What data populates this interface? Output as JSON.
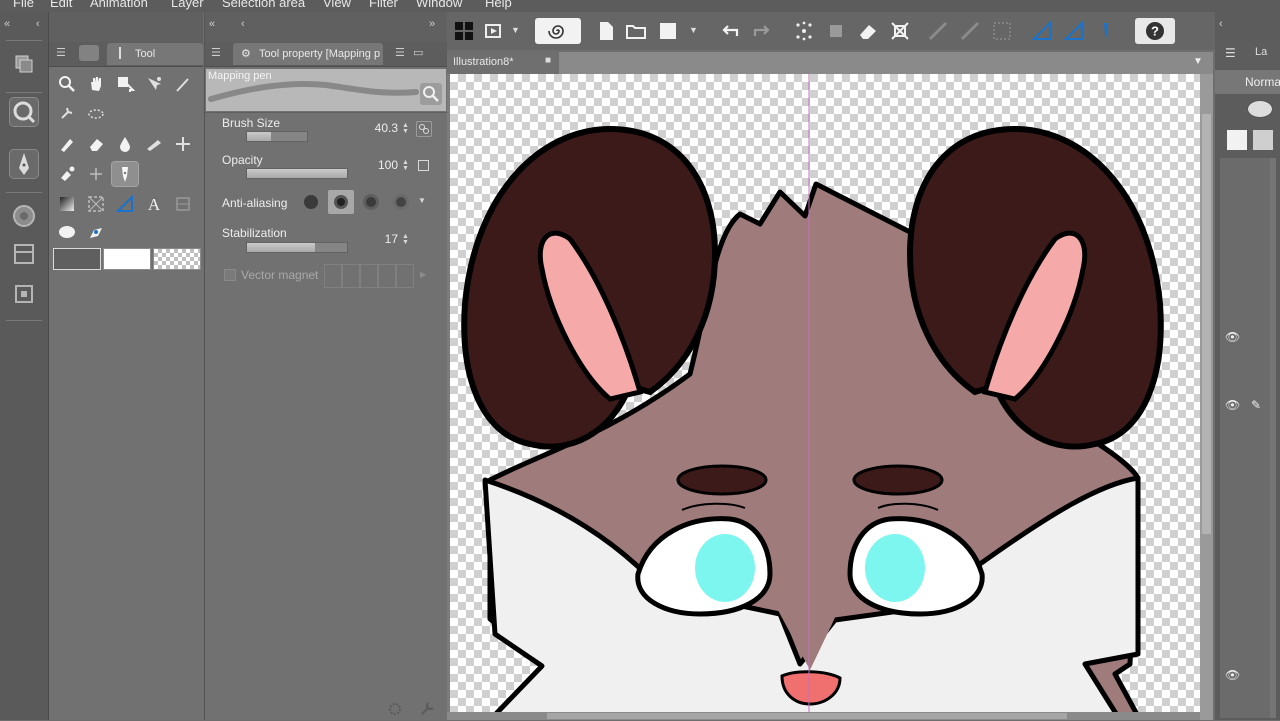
{
  "menu": [
    "File",
    "Edit",
    "Animation",
    "Layer",
    "Selection area",
    "View",
    "Filter",
    "Window",
    "Help"
  ],
  "tool_panel": {
    "tab_label": "Tool"
  },
  "tool_property": {
    "tab_label": "Tool property [Mapping p",
    "preview_label": "Mapping pen",
    "brush_size": {
      "label": "Brush Size",
      "value": "40.3",
      "fill": 0.4
    },
    "opacity": {
      "label": "Opacity",
      "value": "100",
      "fill": 1.0
    },
    "anti_aliasing": {
      "label": "Anti-aliasing",
      "selected_index": 1
    },
    "stabilization": {
      "label": "Stabilization",
      "value": "17",
      "fill": 0.68
    },
    "vector_magnet": {
      "label": "Vector magnet"
    }
  },
  "document": {
    "tab_title": "Illustration8*"
  },
  "layers": {
    "blend_mode": "Norma"
  },
  "colors": {
    "accent_blue": "#1a73c8",
    "horn": "#3d1a1a",
    "inner_ear": "#f5a9a9",
    "fur": "#a07b7b",
    "white_fur": "#f0f0f0",
    "eye": "#7ef6f0",
    "nose": "#f07070"
  },
  "icons": {
    "strip": [
      "layer-icon",
      "magnifier-icon",
      "pen-icon",
      "color-wheel-icon",
      "layer-property-icon",
      "navigator-icon"
    ],
    "tools": [
      "zoom-icon",
      "hand-icon",
      "move-layer-icon",
      "object-selection-icon",
      "eyedropper-icon",
      "lasso-icon",
      "selection-icon",
      "pen-tool-icon",
      "eraser-icon",
      "fill-icon",
      "gradient-icon",
      "figure-icon",
      "frame-icon",
      "text-icon",
      "balloon-icon"
    ],
    "toolbar": [
      "grid-icon",
      "animation-icon",
      "spiral-icon",
      "new-file-icon",
      "open-file-icon",
      "color-swatch-icon",
      "undo-icon",
      "redo-icon",
      "sparkle-icon",
      "transform-icon",
      "eraser-toolbar-icon",
      "fit-icon",
      "ruler-icon",
      "snap-icon",
      "pen-snap-icon",
      "pen-blue-icon",
      "help-icon"
    ]
  }
}
